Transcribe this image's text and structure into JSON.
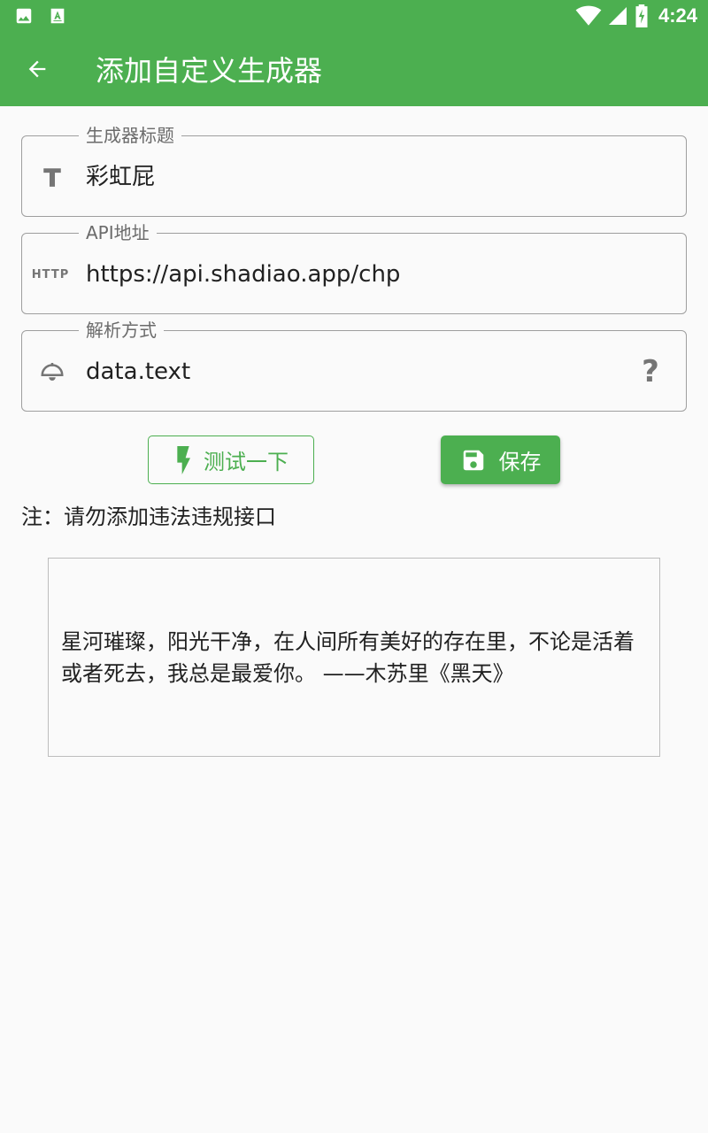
{
  "status_bar": {
    "time": "4:24",
    "icons": [
      "image-icon",
      "app-store-icon",
      "wifi-icon",
      "signal-icon",
      "battery-charging-icon"
    ]
  },
  "app_bar": {
    "title": "添加自定义生成器",
    "back_icon": "arrow-back-icon",
    "color": "#4caf50"
  },
  "form": {
    "title_field": {
      "label": "生成器标题",
      "value": "彩虹屁",
      "icon": "text-icon"
    },
    "api_field": {
      "label": "API地址",
      "value": "https://api.shadiao.app/chp",
      "icon": "http-icon",
      "icon_text": "HTTP"
    },
    "parse_field": {
      "label": "解析方式",
      "value": "data.text",
      "icon": "bell-icon",
      "help_text": "?"
    }
  },
  "buttons": {
    "test_label": "测试一下",
    "save_label": "保存"
  },
  "note": "注：请勿添加违法违规接口",
  "result": "星河璀璨，阳光干净，在人间所有美好的存在里，不论是活着或者死去，我总是最爱你。 ——木苏里《黑天》"
}
